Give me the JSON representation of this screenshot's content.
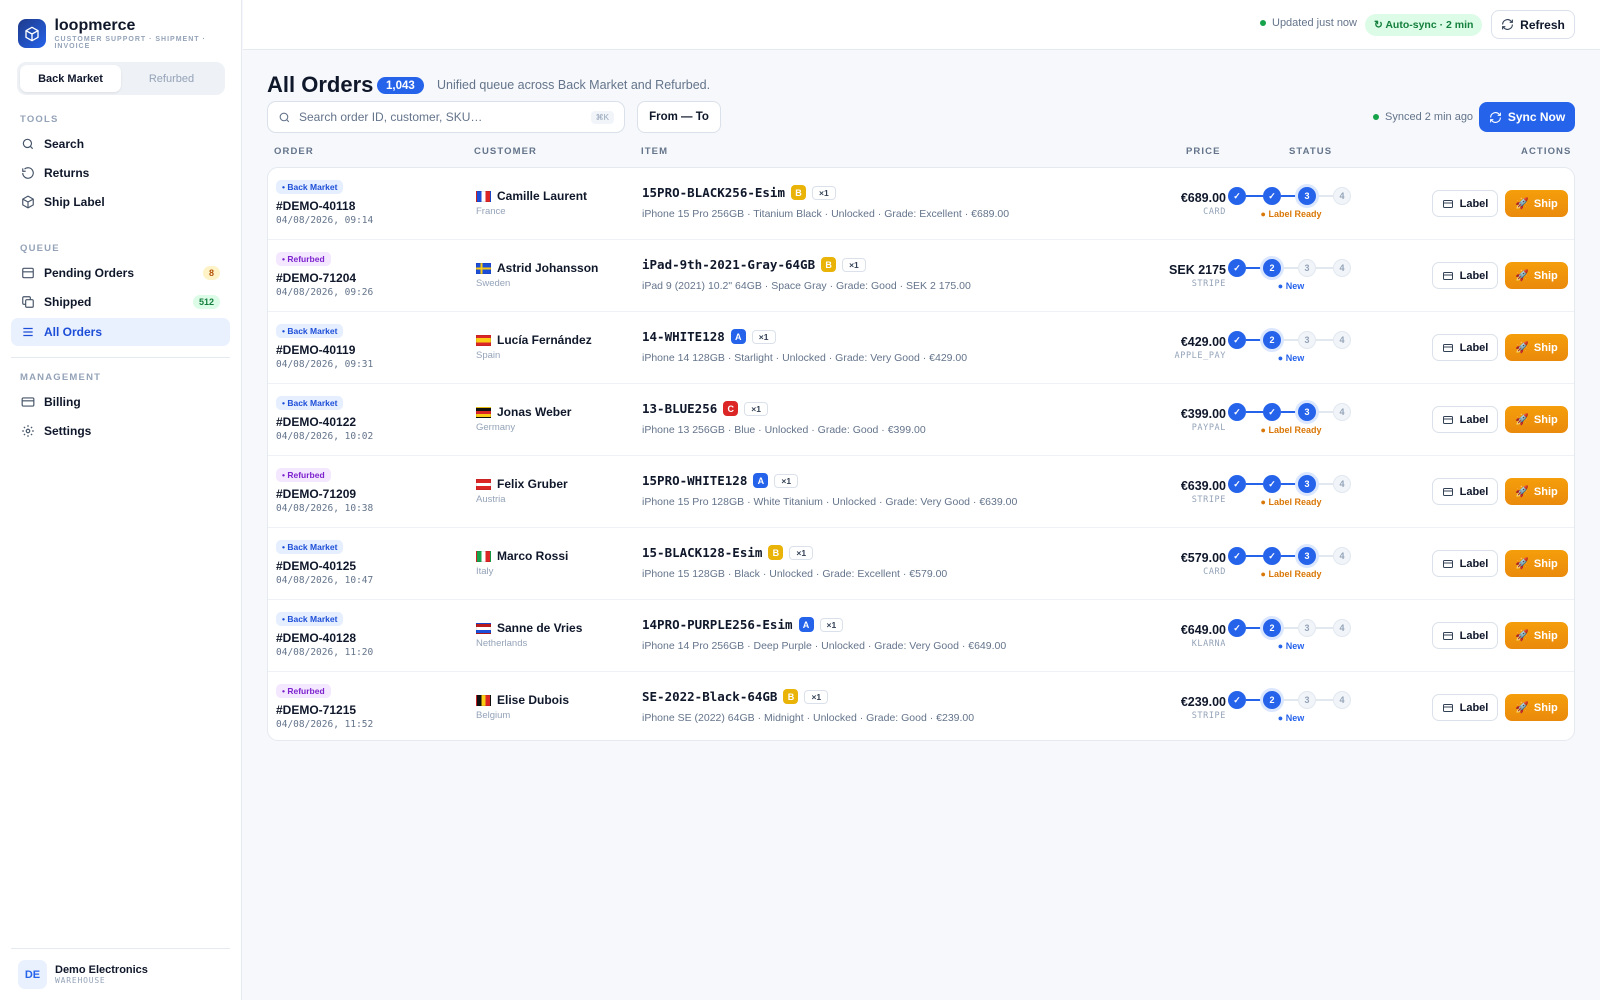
{
  "brand": {
    "name": "loopmerce",
    "tagline": "CUSTOMER SUPPORT · SHIPMENT · INVOICE"
  },
  "marketplace_toggle": {
    "options": [
      "Back Market",
      "Refurbed"
    ],
    "selected": "Back Market"
  },
  "sidebar": {
    "tools_heading": "TOOLS",
    "tools": [
      {
        "label": "Search",
        "icon": "search-icon"
      },
      {
        "label": "Returns",
        "icon": "returns-icon"
      },
      {
        "label": "Ship Label",
        "icon": "package-icon"
      }
    ],
    "queue_heading": "QUEUE",
    "queue": [
      {
        "label": "Pending Orders",
        "icon": "inbox-icon",
        "badge": "8"
      },
      {
        "label": "Shipped",
        "icon": "copy-icon",
        "badge": "512"
      },
      {
        "label": "All Orders",
        "icon": "list-icon",
        "active": true
      }
    ],
    "management_heading": "MANAGEMENT",
    "management": [
      {
        "label": "Billing",
        "icon": "card-icon"
      },
      {
        "label": "Settings",
        "icon": "gear-icon"
      }
    ]
  },
  "user": {
    "initials": "DE",
    "name": "Demo Electronics",
    "role": "WAREHOUSE"
  },
  "topbar": {
    "updated": "Updated just now",
    "autosync": "↻ Auto-sync · 2 min",
    "refresh": "Refresh"
  },
  "header": {
    "title": "All Orders",
    "count": "1,043",
    "subtitle": "Unified queue across Back Market and Refurbed."
  },
  "filters": {
    "search_placeholder": "Search order ID, customer, SKU…",
    "search_value": "",
    "shortcut": "⌘K",
    "date_range": "From — To",
    "synced": "Synced 2 min ago",
    "sync_now": "Sync Now"
  },
  "columns": {
    "order": "ORDER",
    "customer": "CUSTOMER",
    "item": "ITEM",
    "price": "PRICE",
    "status": "STATUS",
    "actions": "ACTIONS"
  },
  "actions": {
    "label": "Label",
    "ship": "Ship"
  },
  "colors": {
    "accent": "#2563eb",
    "ship": "#f59e0b",
    "grade_a": "#2563eb",
    "grade_b": "#eab308",
    "grade_c": "#dc2626"
  },
  "orders": [
    {
      "source": "• Back Market",
      "source_type": "bm",
      "id": "#DEMO-40118",
      "date": "04/08/2026, 09:14",
      "country_code": "fr",
      "customer": "Camille Laurent",
      "country": "France",
      "sku": "15PRO-BLACK256-Esim",
      "grade": "B",
      "qty": "×1",
      "desc": "iPhone 15 Pro 256GB · Titanium Black · Unlocked · Grade: Excellent · €689.00",
      "price": "€689.00",
      "method": "CARD",
      "step": 3,
      "status": "● Label Ready",
      "status_type": "ready"
    },
    {
      "source": "• Refurbed",
      "source_type": "rf",
      "id": "#DEMO-71204",
      "date": "04/08/2026, 09:26",
      "country_code": "se",
      "customer": "Astrid Johansson",
      "country": "Sweden",
      "sku": "iPad-9th-2021-Gray-64GB",
      "grade": "B",
      "qty": "×1",
      "desc": "iPad 9 (2021) 10.2\" 64GB · Space Gray · Grade: Good · SEK 2 175.00",
      "price": "SEK 2175",
      "method": "STRIPE",
      "step": 2,
      "status": "● New",
      "status_type": "new"
    },
    {
      "source": "• Back Market",
      "source_type": "bm",
      "id": "#DEMO-40119",
      "date": "04/08/2026, 09:31",
      "country_code": "es",
      "customer": "Lucía Fernández",
      "country": "Spain",
      "sku": "14-WHITE128",
      "grade": "A",
      "qty": "×1",
      "desc": "iPhone 14 128GB · Starlight · Unlocked · Grade: Very Good · €429.00",
      "price": "€429.00",
      "method": "APPLE_PAY",
      "step": 2,
      "status": "● New",
      "status_type": "new"
    },
    {
      "source": "• Back Market",
      "source_type": "bm",
      "id": "#DEMO-40122",
      "date": "04/08/2026, 10:02",
      "country_code": "de",
      "customer": "Jonas Weber",
      "country": "Germany",
      "sku": "13-BLUE256",
      "grade": "C",
      "qty": "×1",
      "desc": "iPhone 13 256GB · Blue · Unlocked · Grade: Good · €399.00",
      "price": "€399.00",
      "method": "PAYPAL",
      "step": 3,
      "status": "● Label Ready",
      "status_type": "ready"
    },
    {
      "source": "• Refurbed",
      "source_type": "rf",
      "id": "#DEMO-71209",
      "date": "04/08/2026, 10:38",
      "country_code": "at",
      "customer": "Felix Gruber",
      "country": "Austria",
      "sku": "15PRO-WHITE128",
      "grade": "A",
      "qty": "×1",
      "desc": "iPhone 15 Pro 128GB · White Titanium · Unlocked · Grade: Very Good · €639.00",
      "price": "€639.00",
      "method": "STRIPE",
      "step": 3,
      "status": "● Label Ready",
      "status_type": "ready"
    },
    {
      "source": "• Back Market",
      "source_type": "bm",
      "id": "#DEMO-40125",
      "date": "04/08/2026, 10:47",
      "country_code": "it",
      "customer": "Marco Rossi",
      "country": "Italy",
      "sku": "15-BLACK128-Esim",
      "grade": "B",
      "qty": "×1",
      "desc": "iPhone 15 128GB · Black · Unlocked · Grade: Excellent · €579.00",
      "price": "€579.00",
      "method": "CARD",
      "step": 3,
      "status": "● Label Ready",
      "status_type": "ready"
    },
    {
      "source": "• Back Market",
      "source_type": "bm",
      "id": "#DEMO-40128",
      "date": "04/08/2026, 11:20",
      "country_code": "nl",
      "customer": "Sanne de Vries",
      "country": "Netherlands",
      "sku": "14PRO-PURPLE256-Esim",
      "grade": "A",
      "qty": "×1",
      "desc": "iPhone 14 Pro 256GB · Deep Purple · Unlocked · Grade: Very Good · €649.00",
      "price": "€649.00",
      "method": "KLARNA",
      "step": 2,
      "status": "● New",
      "status_type": "new"
    },
    {
      "source": "• Refurbed",
      "source_type": "rf",
      "id": "#DEMO-71215",
      "date": "04/08/2026, 11:52",
      "country_code": "be",
      "customer": "Elise Dubois",
      "country": "Belgium",
      "sku": "SE-2022-Black-64GB",
      "grade": "B",
      "qty": "×1",
      "desc": "iPhone SE (2022) 64GB · Midnight · Unlocked · Grade: Good · €239.00",
      "price": "€239.00",
      "method": "STRIPE",
      "step": 2,
      "status": "● New",
      "status_type": "new"
    }
  ]
}
